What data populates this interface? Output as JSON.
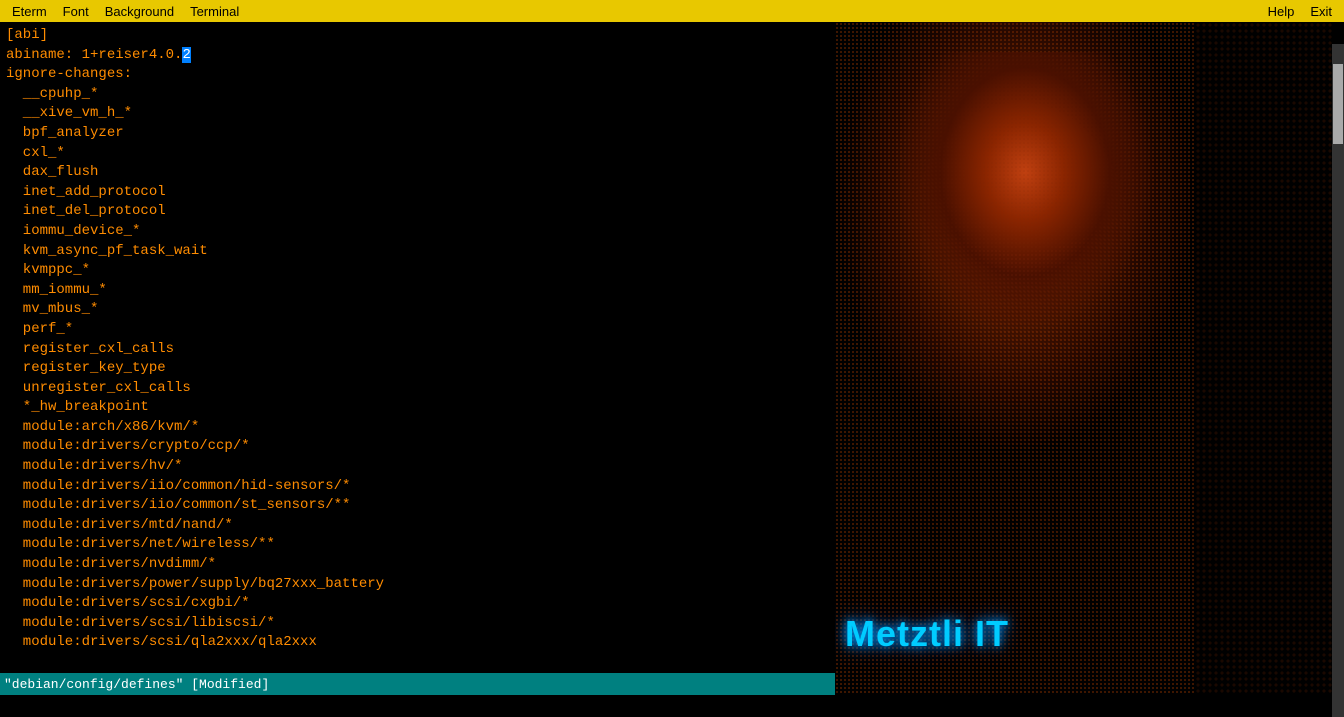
{
  "menubar": {
    "items": [
      {
        "label": "Eterm",
        "id": "eterm"
      },
      {
        "label": "Font",
        "id": "font"
      },
      {
        "label": "Background",
        "id": "background"
      },
      {
        "label": "Terminal",
        "id": "terminal"
      }
    ],
    "right_items": [
      {
        "label": "Help",
        "id": "help"
      },
      {
        "label": "Exit",
        "id": "exit"
      }
    ]
  },
  "terminal": {
    "lines": [
      "[abi]",
      "abiname: 1+reiser4.0.²",
      "ignore-changes:",
      "  __cpuhp_*",
      "  __xive_vm_h_*",
      "  bpf_analyzer",
      "  cxl_*",
      "  dax_flush",
      "  inet_add_protocol",
      "  inet_del_protocol",
      "  iommu_device_*",
      "  kvm_async_pf_task_wait",
      "  kvmppc_*",
      "  mm_iommu_*",
      "  mv_mbus_*",
      "  perf_*",
      "  register_cxl_calls",
      "  register_key_type",
      "  unregister_cxl_calls",
      "  *_hw_breakpoint",
      "  module:arch/x86/kvm/*",
      "  module:drivers/crypto/ccp/*",
      "  module:drivers/hv/*",
      "  module:drivers/iio/common/hid-sensors/*",
      "  module:drivers/iio/common/st_sensors/**",
      "  module:drivers/mtd/nand/*",
      "  module:drivers/net/wireless/**",
      "  module:drivers/nvdimm/*",
      "  module:drivers/power/supply/bq27xxx_battery",
      "  module:drivers/scsi/cxgbi/*",
      "  module:drivers/scsi/libiscsi/*",
      "  module:drivers/scsi/qla2xxx/qla2xxx"
    ],
    "highlighted_char": "2",
    "highlighted_pos": "line2_char20"
  },
  "statusbar": {
    "text": "\"debian/config/defines\" [Modified]"
  },
  "brand": {
    "text": "Metztli IT"
  },
  "colors": {
    "terminal_bg": "#000000",
    "terminal_fg": "#ff8c00",
    "menubar_bg": "#e8c800",
    "statusbar_bg": "#008080",
    "statusbar_fg": "#ffffff",
    "brand_color": "#00ccff",
    "highlight_bg": "#0080ff"
  }
}
